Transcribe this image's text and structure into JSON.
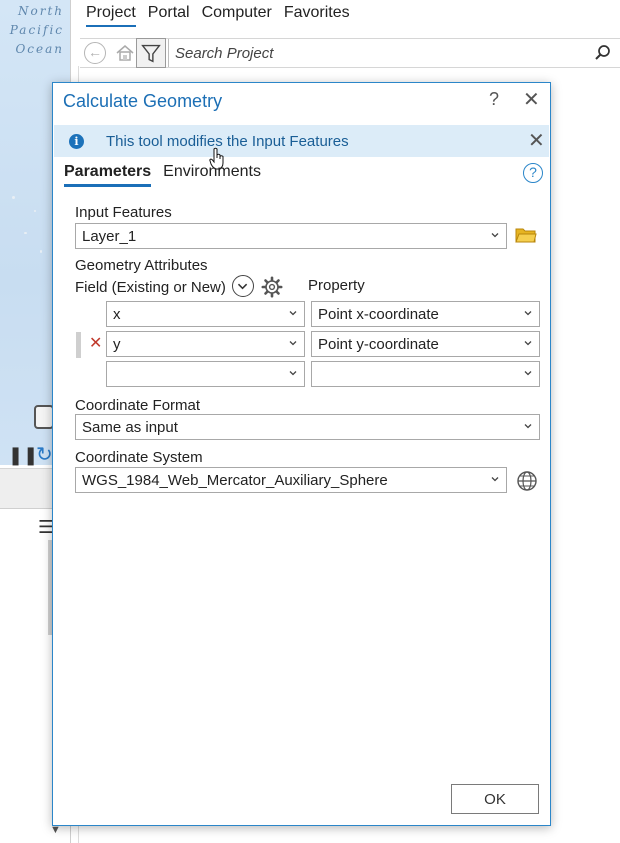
{
  "map": {
    "ocean_label_lines": [
      "North",
      "Pacific",
      "Ocean"
    ]
  },
  "catalog": {
    "tabs": [
      {
        "label": "Project",
        "active": true
      },
      {
        "label": "Portal",
        "active": false
      },
      {
        "label": "Computer",
        "active": false
      },
      {
        "label": "Favorites",
        "active": false
      }
    ],
    "search_placeholder": "Search Project"
  },
  "dialog": {
    "title": "Calculate Geometry",
    "help": "?",
    "close": "✕",
    "info_message": "This tool modifies the Input Features",
    "info_close": "✕",
    "tabs": [
      {
        "label": "Parameters",
        "active": true
      },
      {
        "label": "Environments",
        "active": false
      }
    ],
    "help_button": "?",
    "input_features_label": "Input Features",
    "input_features_value": "Layer_1",
    "geometry_attributes_label": "Geometry Attributes",
    "field_header": "Field (Existing or New)",
    "property_header": "Property",
    "rows": [
      {
        "field": "x",
        "property": "Point x-coordinate"
      },
      {
        "field": "y",
        "property": "Point y-coordinate"
      },
      {
        "field": "",
        "property": ""
      }
    ],
    "remove_row": "✕",
    "coordinate_format_label": "Coordinate Format",
    "coordinate_format_value": "Same as input",
    "coordinate_system_label": "Coordinate System",
    "coordinate_system_value": "WGS_1984_Web_Mercator_Auxiliary_Sphere",
    "ok_label": "OK"
  },
  "colors": {
    "accent": "#1c6fb5",
    "info_banner_bg": "#dcecf8",
    "remove_red": "#c0392b",
    "folder_yellow": "#e6b422"
  }
}
